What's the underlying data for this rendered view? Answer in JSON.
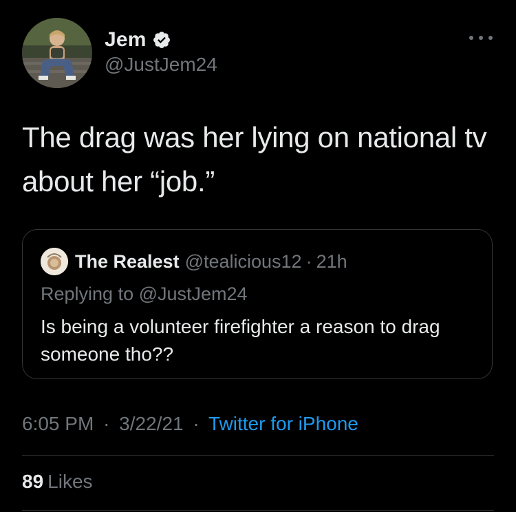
{
  "tweet": {
    "author": {
      "display_name": "Jem",
      "handle": "@JustJem24",
      "verified": true,
      "verified_icon": "verified-badge-icon",
      "avatar": "profile-photo"
    },
    "text": "The drag was her lying on national tv about her “job.”",
    "more_icon": "more-options-icon",
    "quoted_tweet": {
      "display_name": "The Realest",
      "handle": "@tealicious12",
      "separator": "·",
      "time": "21h",
      "replying_to": "Replying to @JustJem24",
      "text": "Is being a volunteer firefighter a reason to drag someone tho??"
    },
    "meta": {
      "time": "6:05 PM",
      "separator": "·",
      "date": "3/22/21",
      "source": "Twitter for iPhone"
    },
    "likes": {
      "count": "89",
      "label": "Likes"
    }
  },
  "colors": {
    "background": "#000000",
    "text_primary": "#e7e9ea",
    "text_secondary": "#71767b",
    "link": "#1d9bf0",
    "border": "#333639"
  }
}
